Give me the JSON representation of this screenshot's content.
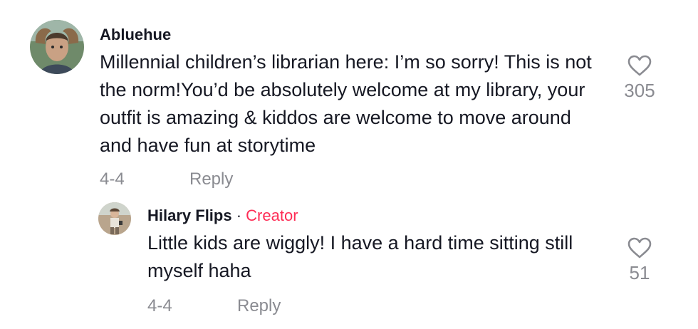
{
  "comment": {
    "username": "Abluehue",
    "text": "Millennial children’s librarian here: I’m so sorry! This is not the norm!You’d be absolutely welcome at my library, your outfit is amazing & kiddos are welcome to move around and have fun at storytime",
    "date": "4-4",
    "reply_label": "Reply",
    "like_count": "305",
    "like_icon": "heart-outline-icon"
  },
  "reply": {
    "username": "Hilary Flips",
    "separator": " · ",
    "creator_badge": "Creator",
    "text": "Little kids are wiggly! I have a hard time sitting still myself haha",
    "date": "4-4",
    "reply_label": "Reply",
    "like_count": "51",
    "like_icon": "heart-outline-icon"
  },
  "colors": {
    "text": "#161823",
    "muted": "#8a8b91",
    "creator": "#fe2c55"
  }
}
